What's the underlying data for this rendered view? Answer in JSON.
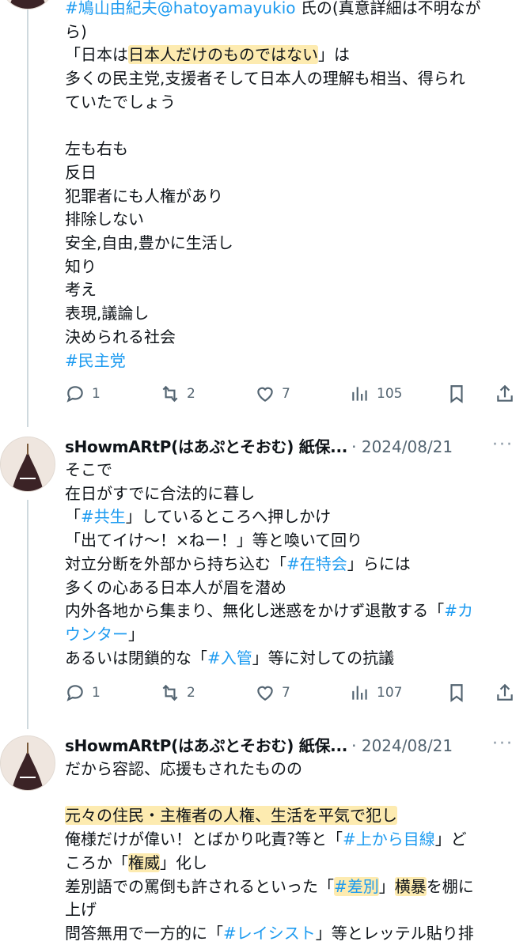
{
  "tweet1": {
    "lines": [
      [
        {
          "t": "#鳩山由紀夫@hatoyamayukio",
          "c": "tag"
        },
        {
          "t": " 氏の(真意詳細は不明なが"
        }
      ],
      [
        {
          "t": "ら)"
        }
      ],
      [
        {
          "t": "「日本は"
        },
        {
          "t": "日本人だけのものではない",
          "c": "hl"
        },
        {
          "t": "」は"
        }
      ],
      [
        {
          "t": "多くの民主党,支援者そして日本人の理解も相当、得られ"
        }
      ],
      [
        {
          "t": "ていたでしょう"
        }
      ],
      [
        {
          "t": ""
        }
      ],
      [
        {
          "t": "左も右も"
        }
      ],
      [
        {
          "t": "反日"
        }
      ],
      [
        {
          "t": "犯罪者にも人権があり"
        }
      ],
      [
        {
          "t": "排除しない"
        }
      ],
      [
        {
          "t": "安全,自由,豊かに生活し"
        }
      ],
      [
        {
          "t": "知り"
        }
      ],
      [
        {
          "t": "考え"
        }
      ],
      [
        {
          "t": "表現,議論し"
        }
      ],
      [
        {
          "t": "決められる社会"
        }
      ],
      [
        {
          "t": "#民主党",
          "c": "tag"
        }
      ]
    ],
    "stats": {
      "replies": "1",
      "reposts": "2",
      "likes": "7",
      "views": "105"
    }
  },
  "tweet2": {
    "author": "sHowmARtP(はあぷとそおむ) 紙保...",
    "date": "· 2024/08/21",
    "more": "···",
    "lines": [
      [
        {
          "t": "そこで"
        }
      ],
      [
        {
          "t": "在日がすでに合法的に暮し"
        }
      ],
      [
        {
          "t": "「"
        },
        {
          "t": "#共生",
          "c": "tag"
        },
        {
          "t": "」しているところへ押しかけ"
        }
      ],
      [
        {
          "t": "「出てイけ〜！×ねー！」等と喚いて回り"
        }
      ],
      [
        {
          "t": "対立分断を外部から持ち込む「"
        },
        {
          "t": "#在特会",
          "c": "tag"
        },
        {
          "t": "」らには"
        }
      ],
      [
        {
          "t": "多くの心ある日本人が眉を潜め"
        }
      ],
      [
        {
          "t": "内外各地から集まり、無化し迷惑をかけず退散する「"
        },
        {
          "t": "#カ",
          "c": "tag"
        }
      ],
      [
        {
          "t": "ウンター",
          "c": "tag"
        },
        {
          "t": "」"
        }
      ],
      [
        {
          "t": "あるいは閉鎖的な「"
        },
        {
          "t": "#入管",
          "c": "tag"
        },
        {
          "t": "」等に対しての抗議"
        }
      ]
    ],
    "stats": {
      "replies": "1",
      "reposts": "2",
      "likes": "7",
      "views": "107"
    }
  },
  "tweet3": {
    "author": "sHowmARtP(はあぷとそおむ) 紙保...",
    "date": "· 2024/08/21",
    "more": "···",
    "lines": [
      [
        {
          "t": "だから容認、応援もされたものの"
        }
      ],
      [
        {
          "t": ""
        }
      ],
      [
        {
          "t": "元々の住民・主権者の人権、生活を平気で犯し",
          "c": "hl"
        }
      ],
      [
        {
          "t": "俺様だけが偉い！とばかり叱責?等と「"
        },
        {
          "t": "#上から目線",
          "c": "tag"
        },
        {
          "t": "」ど"
        }
      ],
      [
        {
          "t": "ころか「"
        },
        {
          "t": "権威",
          "c": "hl"
        },
        {
          "t": "」化し"
        }
      ],
      [
        {
          "t": "差別語での罵倒も許されるといった「"
        },
        {
          "t": "#差別",
          "c": "tag hl"
        },
        {
          "t": "」"
        },
        {
          "t": "横暴",
          "c": "hl"
        },
        {
          "t": "を棚に"
        }
      ],
      [
        {
          "t": "上げ"
        }
      ],
      [
        {
          "t": "問答無用で一方的に「"
        },
        {
          "t": "#レイシスト",
          "c": "tag"
        },
        {
          "t": "」等とレッテル貼り排"
        }
      ]
    ]
  }
}
